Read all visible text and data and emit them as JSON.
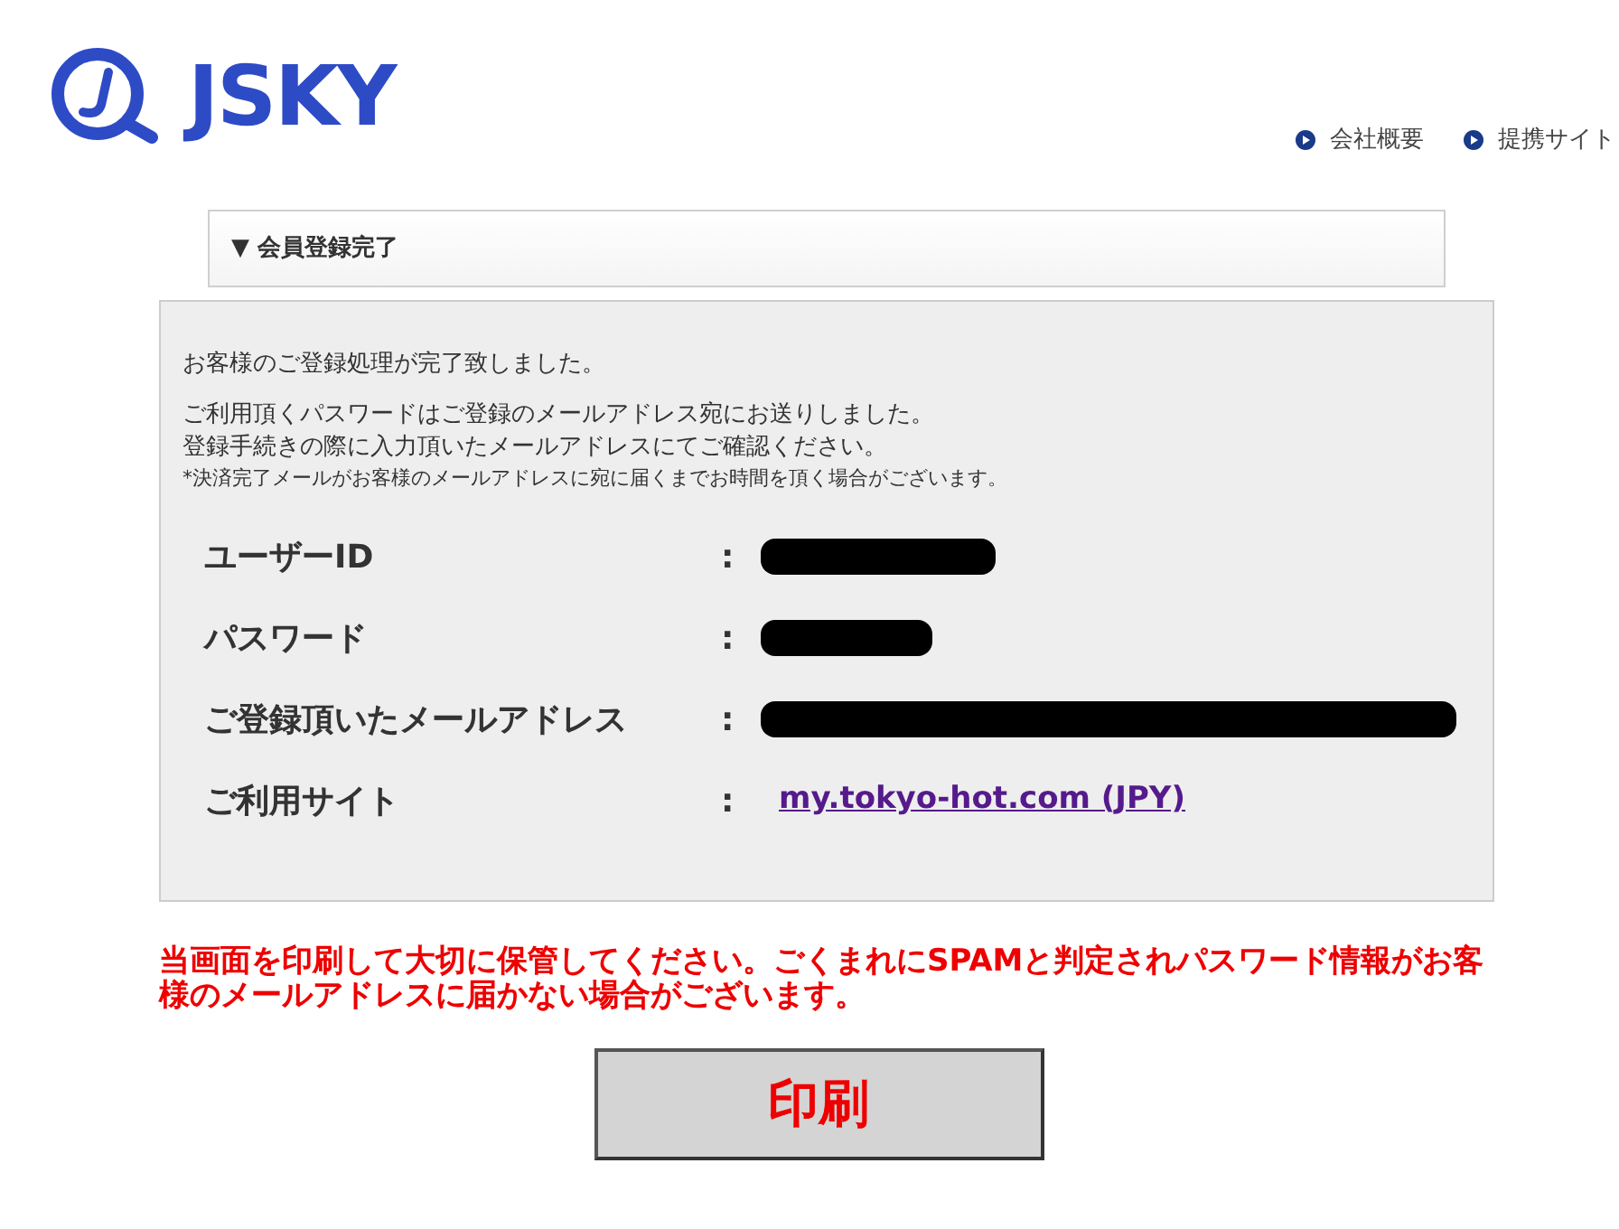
{
  "logo": {
    "text": "JSKY"
  },
  "nav": [
    {
      "label": "会社概要"
    },
    {
      "label": "提携サイト"
    }
  ],
  "section": {
    "title": "▼ 会員登録完了"
  },
  "messages": [
    {
      "kind": "lead",
      "text": "お客様のご登録処理が完了致しました。"
    },
    {
      "kind": "body",
      "text": "ご利用頂くパスワードはご登録のメールアドレス宛にお送りしました。"
    },
    {
      "kind": "body",
      "text": "登録手続きの際に入力頂いたメールアドレスにてご確認ください。"
    },
    {
      "kind": "note",
      "text": "*決済完了メールがお客様のメールアドレスに宛に届くまでお時間を頂く場合がございます。"
    }
  ],
  "fields": [
    {
      "label": "ユーザーID",
      "separator": ":",
      "kind": "redacted"
    },
    {
      "label": "パスワード",
      "separator": ":",
      "kind": "redacted"
    },
    {
      "label": "ご登録頂いたメールアドレス",
      "separator": ":",
      "kind": "redacted"
    },
    {
      "label": "ご利用サイト",
      "separator": ":",
      "kind": "link",
      "value": "my.tokyo-hot.com (JPY)"
    }
  ],
  "warning": "当画面を印刷して大切に保管してください。ごくまれにSPAMと判定されパスワード情報がお客様のメールアドレスに届かない場合がございます。",
  "print_button": "印刷"
}
